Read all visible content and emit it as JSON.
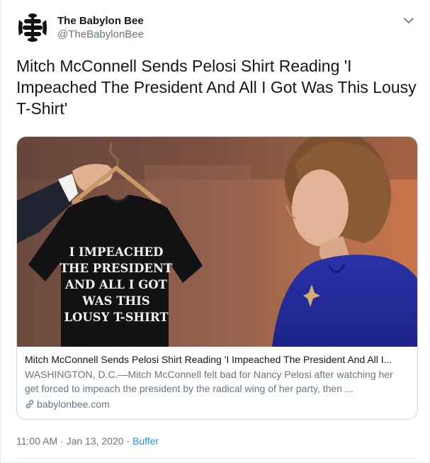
{
  "author": {
    "display_name": "The Babylon Bee",
    "handle": "@TheBabylonBee"
  },
  "tweet": {
    "text": "Mitch McConnell Sends Pelosi Shirt Reading 'I Impeached The President And All I Got Was This Lousy T-Shirt'"
  },
  "card": {
    "title": "Mitch McConnell Sends Pelosi Shirt Reading 'I Impeached The President And All I...",
    "description": "WASHINGTON, D.C.—Mitch McConnell felt bad for Nancy Pelosi after watching her get forced to impeach the president by the radical wing of her party, then ...",
    "domain": "babylonbee.com",
    "shirt_lines": [
      "I IMPEACHED",
      "THE PRESIDENT",
      "AND ALL I GOT",
      "WAS THIS",
      "LOUSY T-SHIRT"
    ]
  },
  "meta": {
    "time": "11:00 AM",
    "separator": " · ",
    "date": "Jan 13, 2020",
    "source": "Buffer"
  },
  "icons": {
    "avatar": "bee-logo-icon",
    "menu": "chevron-down-icon",
    "link": "link-icon"
  },
  "colors": {
    "text": "#14171a",
    "secondary": "#657786",
    "link": "#1b95e0",
    "border": "#ccd6dd"
  }
}
